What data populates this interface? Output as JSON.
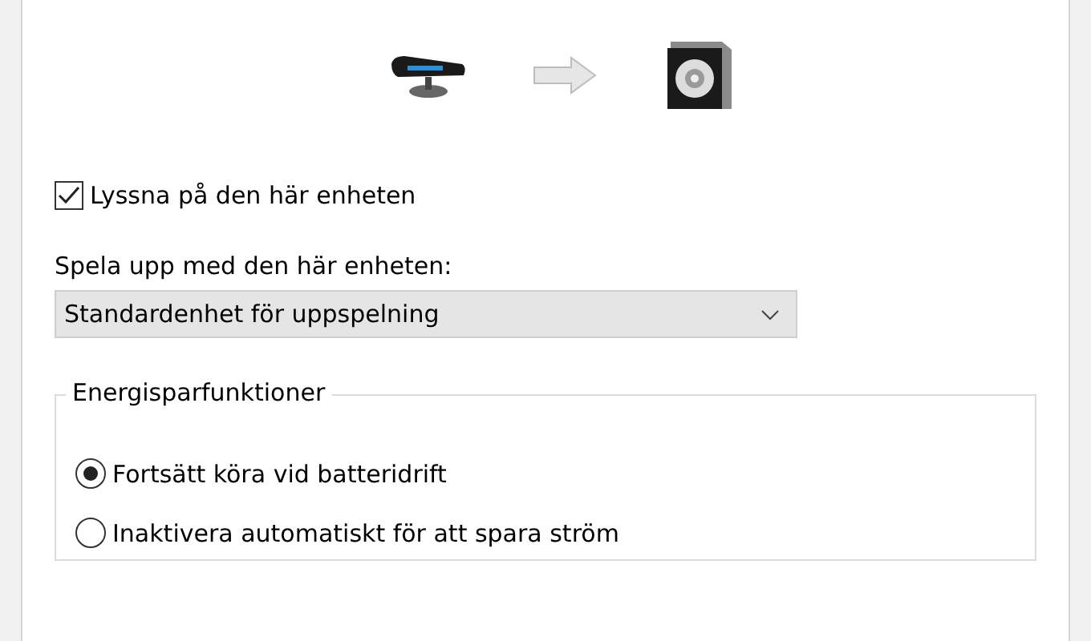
{
  "listen": {
    "label": "Lyssna på den här enheten",
    "checked": true
  },
  "playback": {
    "label": "Spela upp med den här enheten:",
    "value": "Standardenhet för uppspelning"
  },
  "power": {
    "title": "Energisparfunktioner",
    "options": [
      {
        "label": "Fortsätt köra vid batteridrift",
        "selected": true
      },
      {
        "label": "Inaktivera automatiskt för att spara ström",
        "selected": false
      }
    ]
  }
}
